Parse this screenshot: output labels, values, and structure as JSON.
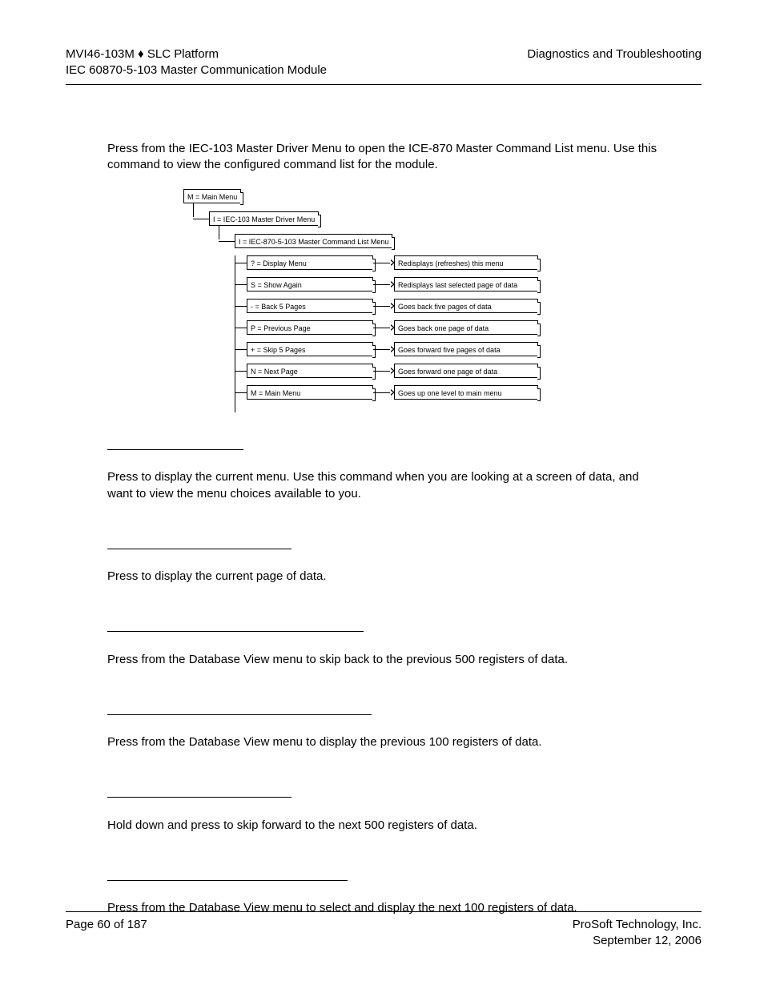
{
  "header": {
    "product": "MVI46-103M ♦ SLC Platform",
    "section": "Diagnostics and Troubleshooting",
    "subtitle": "IEC 60870-5-103 Master Communication Module"
  },
  "intro": "Press       from the IEC-103 Master Driver Menu to open the ICE-870 Master Command List menu. Use this command to view the configured command list for the module.",
  "diagram": {
    "level1": "M = Main Menu",
    "level2": "I = IEC-103 Master Driver Menu",
    "level3": "I = IEC-870-5-103 Master Command List Menu",
    "items": [
      {
        "key": "? = Display Menu",
        "desc": "Redisplays (refreshes) this menu"
      },
      {
        "key": "S = Show Again",
        "desc": "Redisplays last selected page of data"
      },
      {
        "key": "- = Back 5 Pages",
        "desc": "Goes back five pages of data"
      },
      {
        "key": "P = Previous Page",
        "desc": "Goes back one page of data"
      },
      {
        "key": "+ = Skip 5 Pages",
        "desc": "Goes forward five pages of data"
      },
      {
        "key": "N = Next Page",
        "desc": "Goes forward one page of data"
      },
      {
        "key": "M = Main Menu",
        "desc": "Goes up one level to main menu"
      }
    ]
  },
  "sections": {
    "s1": "Press       to display the current menu. Use this command when you are looking at a screen of data, and want to view the menu choices available to you.",
    "s2": "Press       to display the current page of data.",
    "s3": "Press       from the Database View menu to skip back to the previous 500 registers of data.",
    "s4": "Press       from the Database View menu to display the previous 100 registers of data.",
    "s5": "Hold down               and press        to skip forward to the next 500 registers of data.",
    "s6": "Press       from the Database View menu to select and display the next 100 registers of data."
  },
  "footer": {
    "page": "Page 60 of 187",
    "company": "ProSoft Technology, Inc.",
    "date": "September 12, 2006"
  }
}
